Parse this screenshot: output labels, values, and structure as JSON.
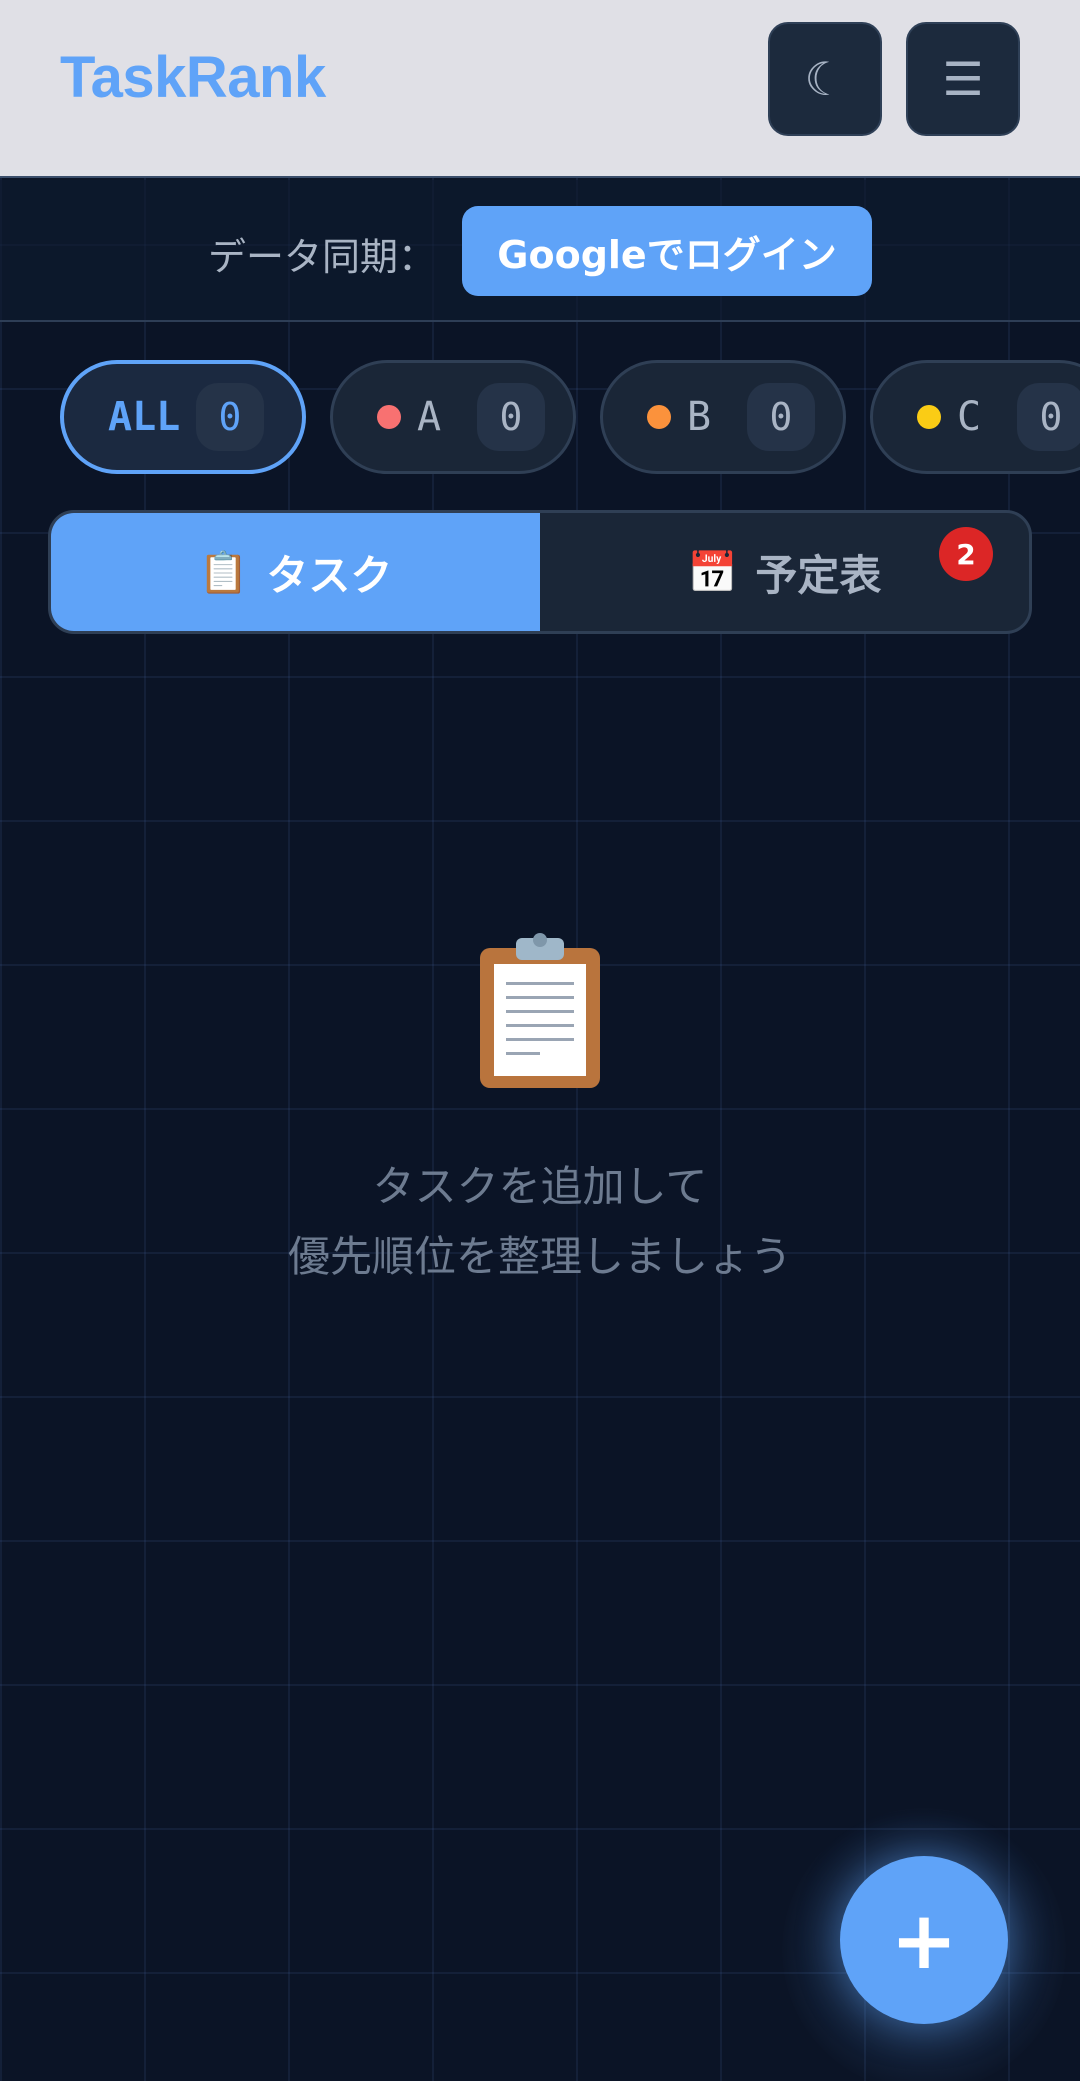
{
  "app": {
    "title": "TaskRank"
  },
  "header": {
    "theme_icon": "☾",
    "menu_icon": "☰"
  },
  "sync": {
    "label": "データ同期：",
    "login_button": "Googleでログイン"
  },
  "filters": [
    {
      "label": "ALL",
      "count": "0",
      "color": ""
    },
    {
      "label": "A",
      "count": "0",
      "color": "#f87171"
    },
    {
      "label": "B",
      "count": "0",
      "color": "#fb923c"
    },
    {
      "label": "C",
      "count": "0",
      "color": "#facc15"
    }
  ],
  "tabs": [
    {
      "icon": "📋",
      "label": "タスク",
      "active": true
    },
    {
      "icon": "📅",
      "label": "予定表",
      "badge": "2"
    }
  ],
  "empty_state": {
    "icon": "clipboard-icon",
    "line1": "タスクを追加して",
    "line2": "優先順位を整理しましょう"
  },
  "fab": {
    "label": "+"
  },
  "colors": {
    "accent": "#5fa3f8",
    "background": "#0b1426",
    "badge": "#dc2626"
  }
}
